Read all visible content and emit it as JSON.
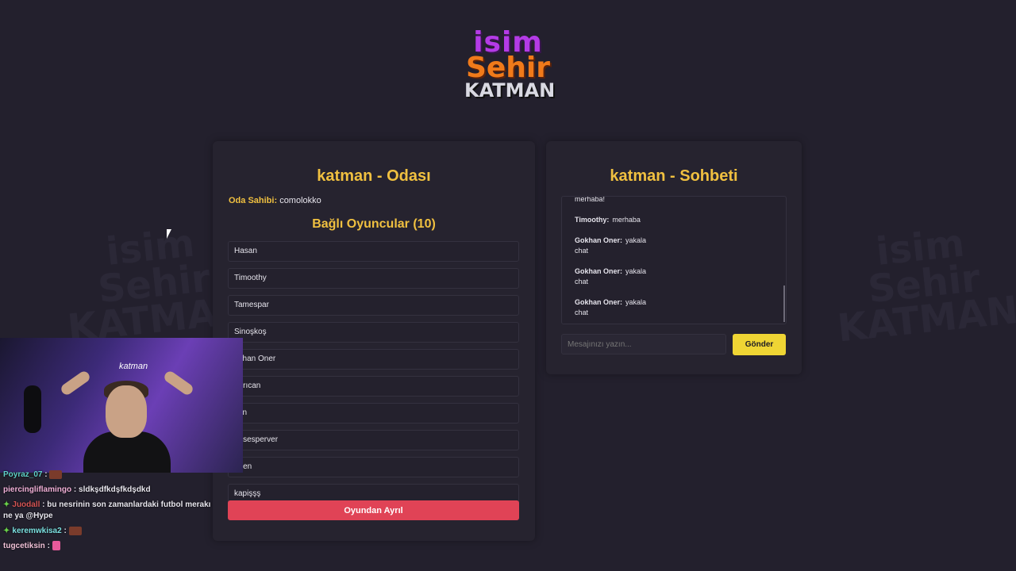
{
  "logo": {
    "line1": "isim",
    "line2": "Sehir",
    "line3": "KATMAN"
  },
  "room": {
    "title": "katman - Odası",
    "owner_label": "Oda Sahibi:",
    "owner_value": "comolokko",
    "players_title": "Bağlı Oyuncular (10)",
    "players": [
      "Hasan",
      "Timoothy",
      "Tamespar",
      "Sinoşkoş",
      "okhan Oner",
      "ağrıcan",
      "srin",
      "ensesperver",
      "riben",
      "kapişşş"
    ],
    "leave_label": "Oyundan Ayrıl"
  },
  "chat": {
    "title": "katman - Sohbeti",
    "messages": [
      {
        "name": "",
        "text": "merhaba!"
      },
      {
        "name": "Timoothy:",
        "text": "merhaba"
      },
      {
        "name": "Gokhan Oner:",
        "text": "yakala",
        "cont": "chat"
      },
      {
        "name": "Gokhan Oner:",
        "text": "yakala",
        "cont": "chat"
      },
      {
        "name": "Gokhan Oner:",
        "text": "yakala",
        "cont": "chat"
      }
    ],
    "input_placeholder": "Mesajınızı yazın...",
    "send_label": "Gönder"
  },
  "stream_chat": [
    {
      "user": "Poyraz_07",
      "sep": " :",
      "text": ""
    },
    {
      "user": "piercingliflamingo",
      "sep": " : ",
      "text": "sldkşdfkdşfkdşdkd"
    },
    {
      "user": "Juodall",
      "sep": " : ",
      "text": "bu nesrinin son zamanlardaki futbol merakı ne ya @Hype"
    },
    {
      "user": "keremwkisa2",
      "sep": " :",
      "text": ""
    },
    {
      "user": "tugcetiksin",
      "sep": " :",
      "text": ""
    }
  ],
  "stream_cam": {
    "neon_text": "katman"
  },
  "colors": {
    "background": "#23202d",
    "panel": "#26232f",
    "accent_gold": "#f0c040",
    "leave_red": "#e04356",
    "send_yellow": "#efd534"
  }
}
